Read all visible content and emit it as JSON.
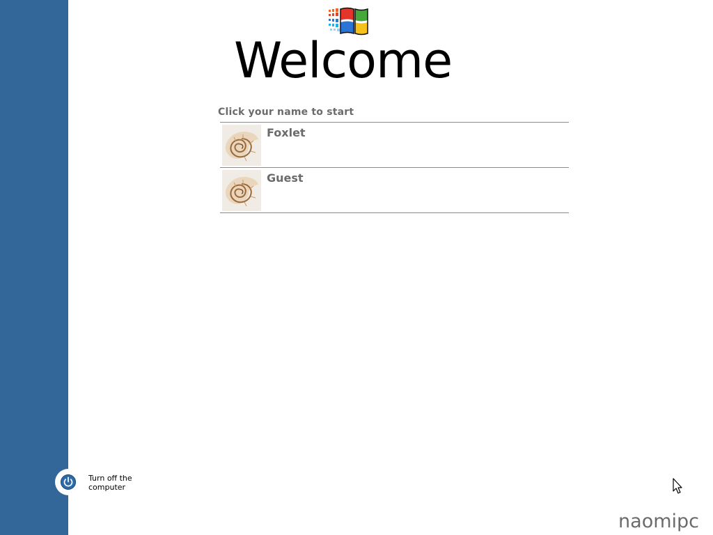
{
  "screen": {
    "title": "Welcome",
    "instruction": "Click your name to start",
    "computer_name": "naomipc"
  },
  "users": [
    {
      "name": "Foxlet",
      "avatar_icon": "nautilus-shell-icon"
    },
    {
      "name": "Guest",
      "avatar_icon": "nautilus-shell-icon"
    }
  ],
  "power": {
    "label": "Turn off the computer",
    "icon": "power-icon"
  },
  "colors": {
    "sidebar": "#336699",
    "text_gray": "#6b6b6b",
    "divider": "#8a8a8a",
    "power_blue": "#2e6aa6"
  }
}
